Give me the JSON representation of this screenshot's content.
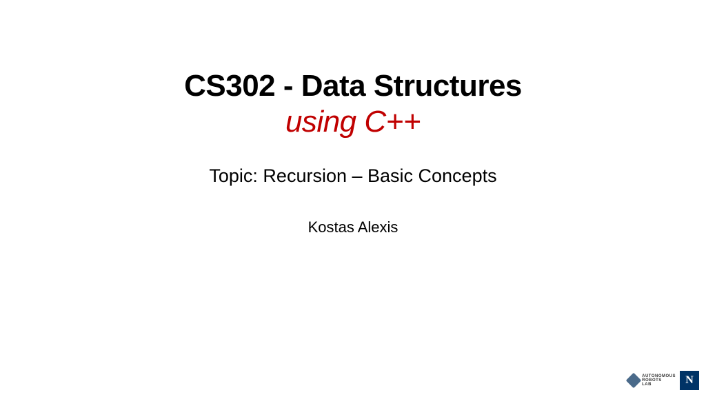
{
  "title": {
    "line1": "CS302 - Data Structures",
    "line2": "using C++"
  },
  "topic": "Topic: Recursion – Basic Concepts",
  "author": "Kostas Alexis",
  "footer": {
    "lab": {
      "line1": "AUTONOMOUS",
      "line2": "ROBOTS",
      "line3": "LAB"
    },
    "univ_letter": "N"
  }
}
